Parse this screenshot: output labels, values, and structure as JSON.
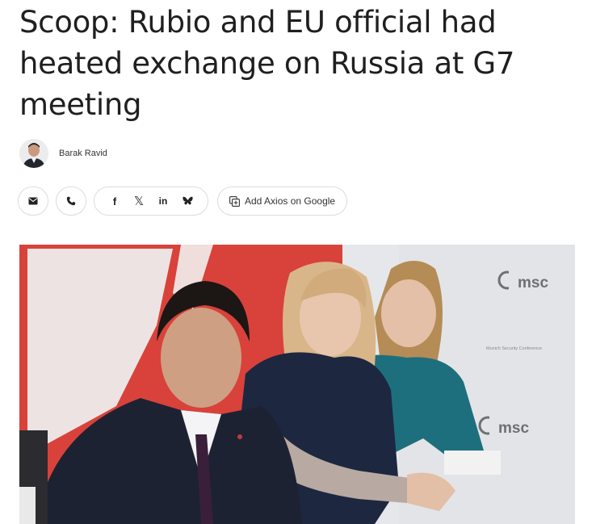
{
  "article": {
    "headline": "Scoop: Rubio and EU official had heated exchange on Russia at G7 meeting"
  },
  "byline": {
    "author": "Barak Ravid"
  },
  "share": {
    "email_icon": "mail-icon",
    "phone_icon": "phone-icon",
    "facebook_glyph": "f",
    "x_glyph": "𝕏",
    "linkedin_glyph": "in",
    "bluesky_icon": "butterfly-icon",
    "google_label": "Add Axios on Google"
  },
  "photo": {
    "backdrop_logo_top": "msc",
    "backdrop_logo_bottom": "msc",
    "backdrop_small_text": "Munich Security Conference"
  },
  "colors": {
    "flag_red": "#d8423a",
    "backdrop": "#e6e7ea",
    "suit_navy": "#1d2233",
    "top_teal": "#1d6f7d"
  }
}
